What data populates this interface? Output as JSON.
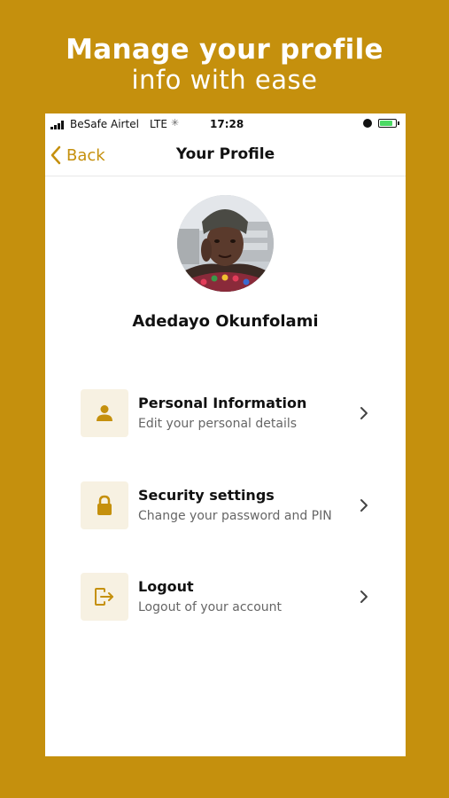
{
  "promo": {
    "line1": "Manage your profile",
    "line2": "info with ease"
  },
  "status_bar": {
    "carrier": "BeSafe Airtel",
    "network": "LTE",
    "time": "17:28"
  },
  "nav": {
    "back_label": "Back",
    "title": "Your Profile"
  },
  "profile": {
    "name": "Adedayo Okunfolami"
  },
  "menu": [
    {
      "title": "Personal Information",
      "subtitle": "Edit your personal details",
      "icon": "person-icon"
    },
    {
      "title": "Security settings",
      "subtitle": "Change your password and PIN",
      "icon": "lock-icon"
    },
    {
      "title": "Logout",
      "subtitle": "Logout of your account",
      "icon": "logout-icon"
    }
  ],
  "colors": {
    "brand": "#C5900D",
    "icon_tile": "#F7F1E2",
    "text": "#111111",
    "subtext": "#666666"
  }
}
